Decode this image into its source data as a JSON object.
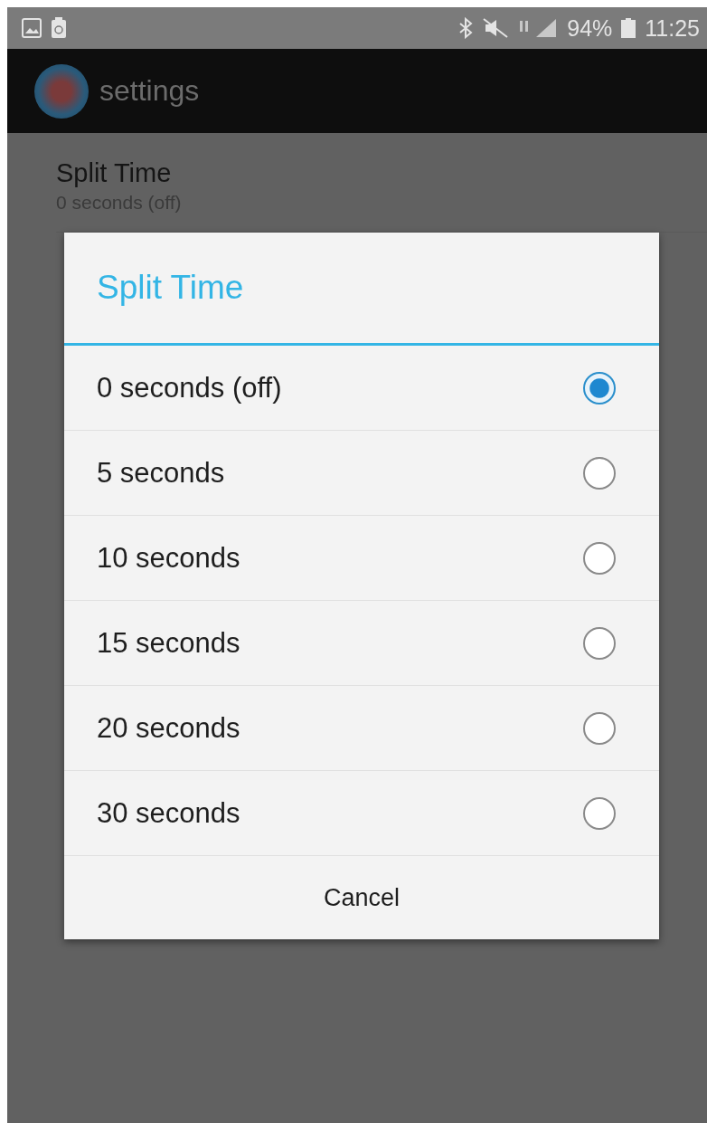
{
  "status_bar": {
    "battery": "94%",
    "time": "11:25"
  },
  "app_bar": {
    "title": "settings"
  },
  "preferences": [
    {
      "title": "Split Time",
      "summary": "0 seconds (off)"
    }
  ],
  "dialog": {
    "title": "Split Time",
    "options": [
      {
        "label": "0 seconds (off)",
        "selected": true
      },
      {
        "label": "5 seconds",
        "selected": false
      },
      {
        "label": "10 seconds",
        "selected": false
      },
      {
        "label": "15 seconds",
        "selected": false
      },
      {
        "label": "20 seconds",
        "selected": false
      },
      {
        "label": "30 seconds",
        "selected": false
      }
    ],
    "buttons": [
      "Cancel"
    ]
  }
}
